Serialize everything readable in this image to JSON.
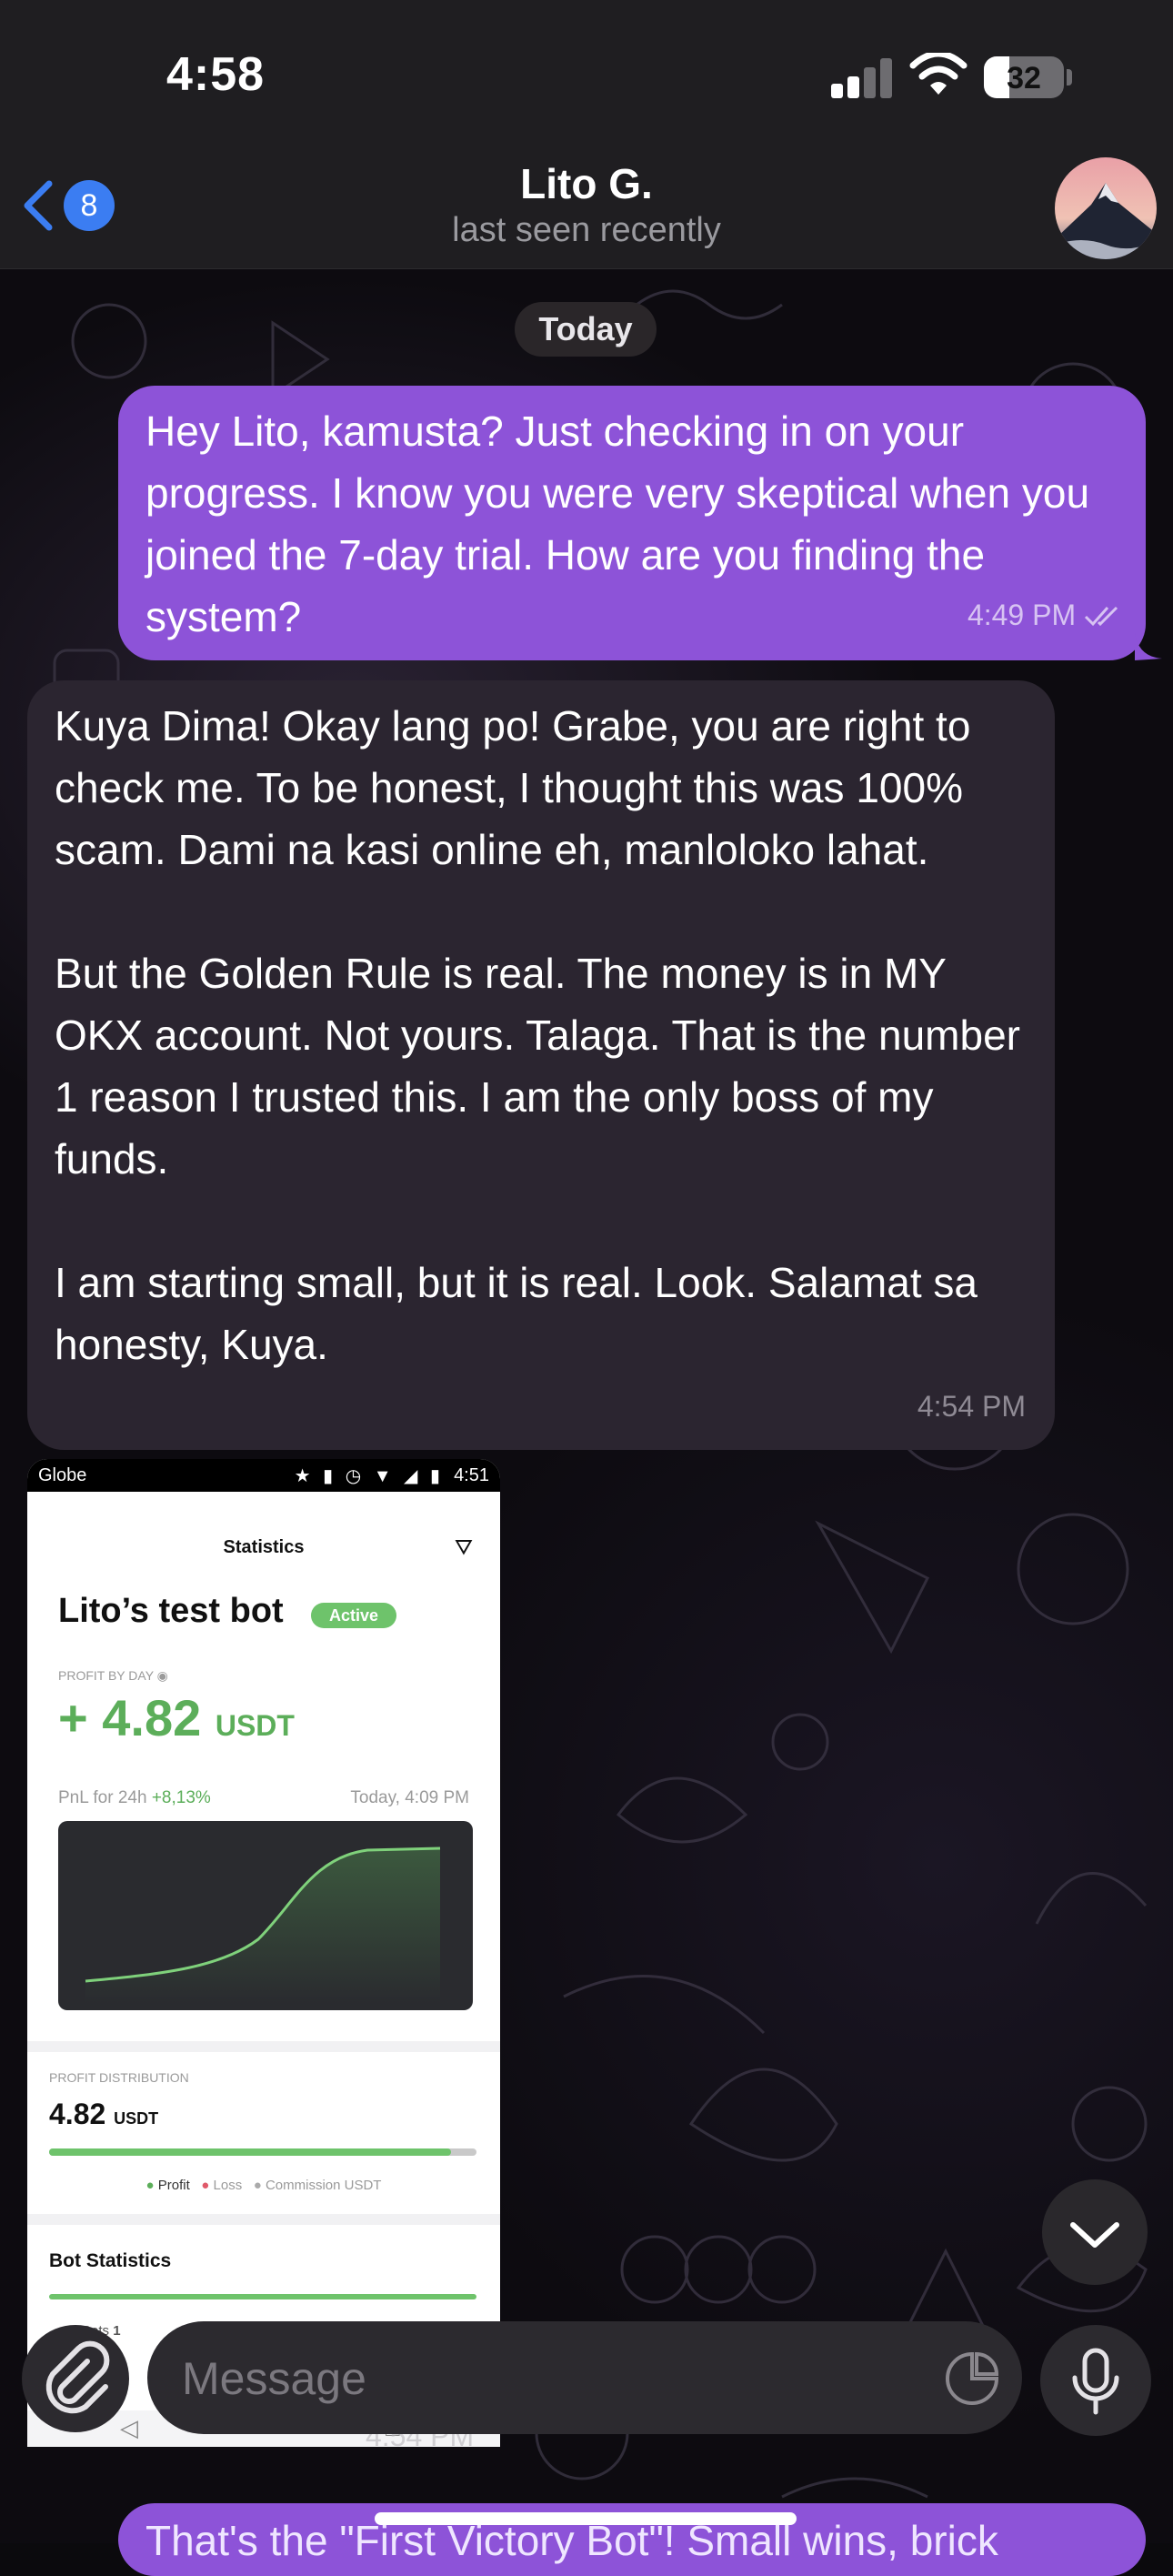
{
  "status_bar": {
    "time": "4:58",
    "battery": "32"
  },
  "header": {
    "back_badge": "8",
    "contact_name": "Lito G.",
    "presence": "last seen recently"
  },
  "date_divider": "Today",
  "messages": [
    {
      "direction": "outgoing",
      "text": "Hey Lito, kamusta? Just checking in on your progress. I know you were very skeptical when you joined the 7-day trial. How are you finding the system?",
      "time": "4:49 PM"
    },
    {
      "direction": "incoming",
      "text": "Kuya Dima! Okay lang po! Grabe, you are right to check me. To be honest, I thought this was 100% scam. Dami na kasi online eh, manloloko lahat.\n\nBut the Golden Rule is real. The money is in MY OKX account. Not yours. Talaga. That is the number 1 reason I trusted this. I am the only boss of my funds.\n\nI am starting small, but it is real. Look. Salamat sa honesty, Kuya.",
      "time": "4:54 PM"
    }
  ],
  "image_message": {
    "time": "4:54 PM",
    "screenshot": {
      "carrier": "Globe",
      "clock": "4:51",
      "app_title": "Statistics",
      "bot_name": "Lito’s test bot",
      "status": "Active",
      "profit_label": "PROFIT BY DAY",
      "profit_value": "+ 4.82",
      "profit_unit": "USDT",
      "pnl_label": "PnL for 24h",
      "pnl_value": "+8,13%",
      "pnl_time": "Today, 4:09 PM",
      "distribution_label": "PROFIT DISTRIBUTION",
      "distribution_value": "4.82",
      "distribution_unit": "USDT",
      "distribution_profit_fraction": 0.94,
      "legend": [
        "Profit",
        "Loss",
        "Commission USDT"
      ],
      "section_title": "Bot Statistics",
      "bots_label": "Bots",
      "bots_value": "1"
    }
  },
  "peek_message": {
    "text": "That's the \"First Victory Bot\"! Small wins, brick"
  },
  "composer": {
    "placeholder": "Message"
  },
  "colors": {
    "outgoing_bubble": "#8d53d8",
    "incoming_bubble": "#2b2530",
    "accent": "#3b7df2",
    "profit_green": "#5cae5a"
  }
}
